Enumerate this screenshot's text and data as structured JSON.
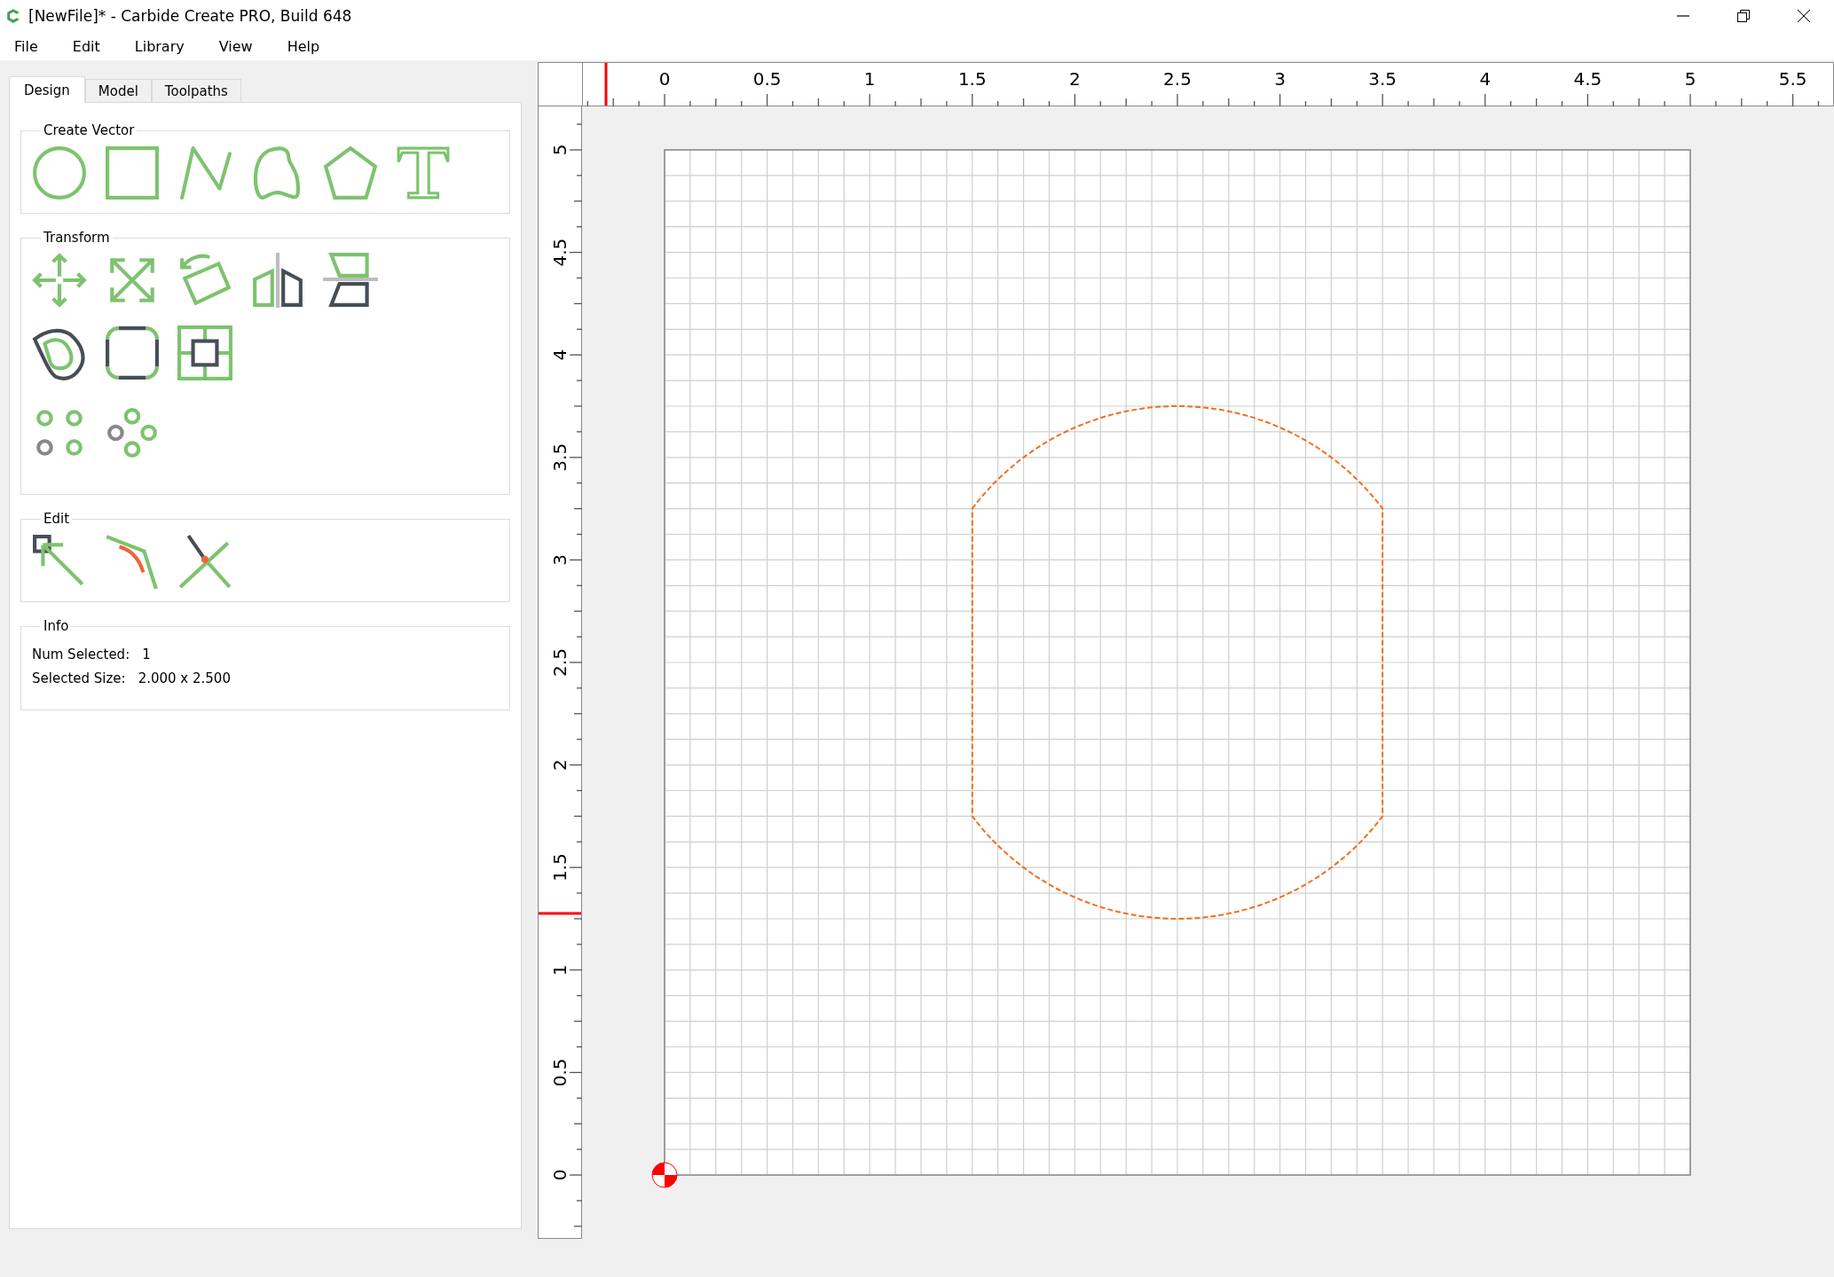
{
  "window": {
    "title": "[NewFile]* - Carbide Create PRO, Build 648"
  },
  "menu": [
    "File",
    "Edit",
    "Library",
    "View",
    "Help"
  ],
  "tabs": [
    {
      "label": "Design",
      "selected": true
    },
    {
      "label": "Model",
      "selected": false
    },
    {
      "label": "Toolpaths",
      "selected": false
    }
  ],
  "groups": [
    {
      "title": "Create Vector"
    },
    {
      "title": "Transform"
    },
    {
      "title": "Edit"
    }
  ],
  "info": {
    "title": "Info",
    "rows": [
      {
        "label": "Num Selected:",
        "value": "1"
      },
      {
        "label": "Selected Size:",
        "value": "2.000 x 2.500"
      }
    ]
  },
  "rulers": {
    "top_labels": [
      "0",
      "0.5",
      "1",
      "1.5",
      "2",
      "2.5",
      "3",
      "3.5",
      "4",
      "4.5",
      "5",
      "5.5"
    ],
    "left_labels": [
      "0",
      "0.5",
      "1",
      "1.5",
      "2",
      "2.5",
      "3",
      "3.5",
      "4",
      "4.5",
      "5"
    ]
  }
}
